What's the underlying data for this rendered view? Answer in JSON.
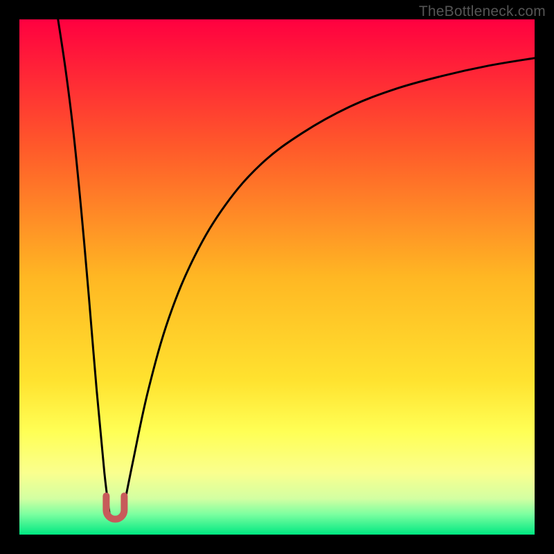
{
  "watermark": "TheBottleneck.com",
  "chart_data": {
    "type": "line",
    "title": "",
    "xlabel": "",
    "ylabel": "",
    "xlim": [
      0,
      100
    ],
    "ylim": [
      0,
      100
    ],
    "grid": false,
    "legend": false,
    "background_gradient": {
      "stops": [
        {
          "pos": 0,
          "color": "#ff0040"
        },
        {
          "pos": 25,
          "color": "#ff5a2a"
        },
        {
          "pos": 50,
          "color": "#ffb723"
        },
        {
          "pos": 70,
          "color": "#ffe22f"
        },
        {
          "pos": 80,
          "color": "#ffff55"
        },
        {
          "pos": 88,
          "color": "#faff8e"
        },
        {
          "pos": 93,
          "color": "#d3ffa2"
        },
        {
          "pos": 96,
          "color": "#7dffa0"
        },
        {
          "pos": 100,
          "color": "#00e882"
        }
      ]
    },
    "series": [
      {
        "name": "left-branch",
        "x": [
          7.5,
          9,
          10.5,
          12,
          13.5,
          15,
          16.5,
          17.5
        ],
        "y": [
          100,
          90,
          78,
          63,
          46,
          28,
          12,
          4
        ]
      },
      {
        "name": "right-branch",
        "x": [
          20,
          22,
          25,
          29,
          34,
          40,
          47,
          55,
          64,
          73,
          82,
          91,
          100
        ],
        "y": [
          4,
          14,
          28,
          42,
          54,
          64,
          72,
          78,
          83,
          86.5,
          89,
          91,
          92.5
        ]
      }
    ],
    "marker": {
      "name": "minimum-marker",
      "shape": "u",
      "color": "#c75a5a",
      "x_center": 18.6,
      "y": 3,
      "width": 3.5,
      "height": 4.5
    }
  }
}
